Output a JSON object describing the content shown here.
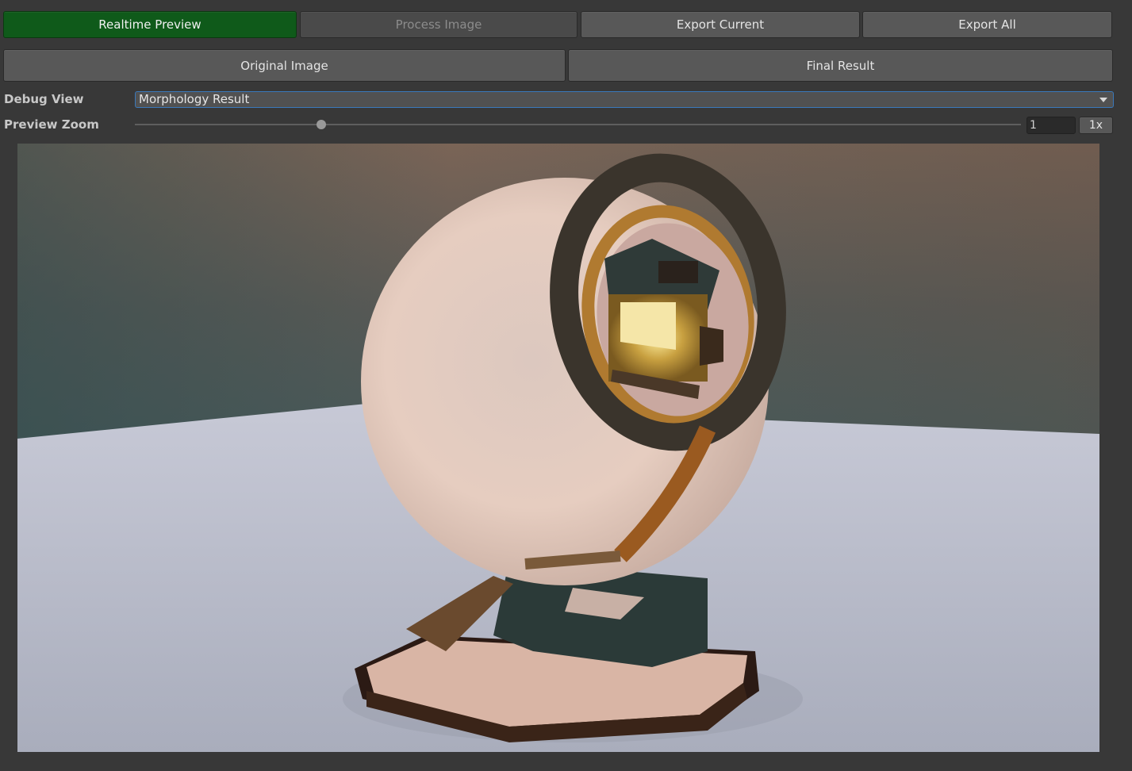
{
  "toolbar": {
    "realtime_preview": "Realtime Preview",
    "process_image": "Process Image",
    "export_current": "Export Current",
    "export_all": "Export All"
  },
  "views": {
    "original_image": "Original Image",
    "final_result": "Final Result"
  },
  "debug_view": {
    "label": "Debug View",
    "selected": "Morphology Result"
  },
  "preview_zoom": {
    "label": "Preview Zoom",
    "value": "1",
    "reset_label": "1x",
    "slider_fraction": 0.21
  },
  "preview": {
    "content": "material-ball-render-icon"
  },
  "colors": {
    "active_button": "#0f5a1a",
    "panel_background": "#383838",
    "button_background": "#585858",
    "dropdown_focus_border": "#3a79bb"
  }
}
